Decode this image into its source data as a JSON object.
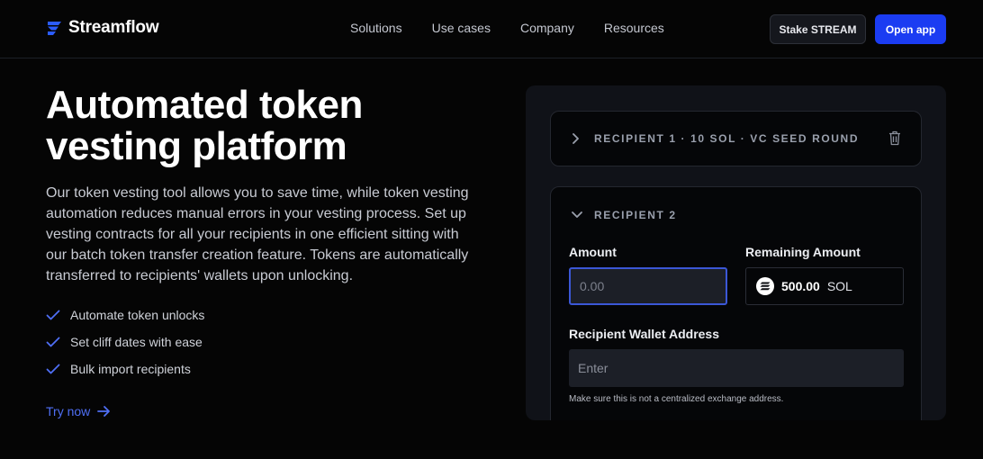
{
  "brand": {
    "name": "Streamflow",
    "accent": "#1b3cf2"
  },
  "nav": {
    "links": [
      "Solutions",
      "Use cases",
      "Company",
      "Resources"
    ],
    "stake_label": "Stake STREAM",
    "open_label": "Open app"
  },
  "hero": {
    "title": "Automated token vesting platform",
    "description": "Our token vesting tool allows you to save time, while token vesting automation reduces manual errors in your vesting process. Set up vesting contracts for all your recipients in one efficient sitting with our batch token transfer creation feature. Tokens are automatically transferred to recipients' wallets upon unlocking.",
    "features": [
      "Automate token unlocks",
      "Set cliff dates with ease",
      "Bulk import recipients"
    ],
    "cta": "Try now"
  },
  "form": {
    "recipient1": {
      "label": "RECIPIENT 1 · 10 SOL · VC SEED ROUND"
    },
    "recipient2": {
      "label": "RECIPIENT 2",
      "amount_label": "Amount",
      "amount_placeholder": "0.00",
      "remaining_label": "Remaining Amount",
      "remaining_value": "500.00",
      "remaining_unit": "SOL",
      "wallet_label": "Recipient Wallet Address",
      "wallet_placeholder": "Enter",
      "hint": "Make sure this is not a centralized exchange address."
    }
  },
  "icons": {
    "logo": "streamflow-logo-icon",
    "check": "check-icon",
    "arrow": "arrow-right-icon",
    "chevron_right": "chevron-right-icon",
    "chevron_down": "chevron-down-icon",
    "trash": "trash-icon",
    "token": "solana-icon"
  }
}
